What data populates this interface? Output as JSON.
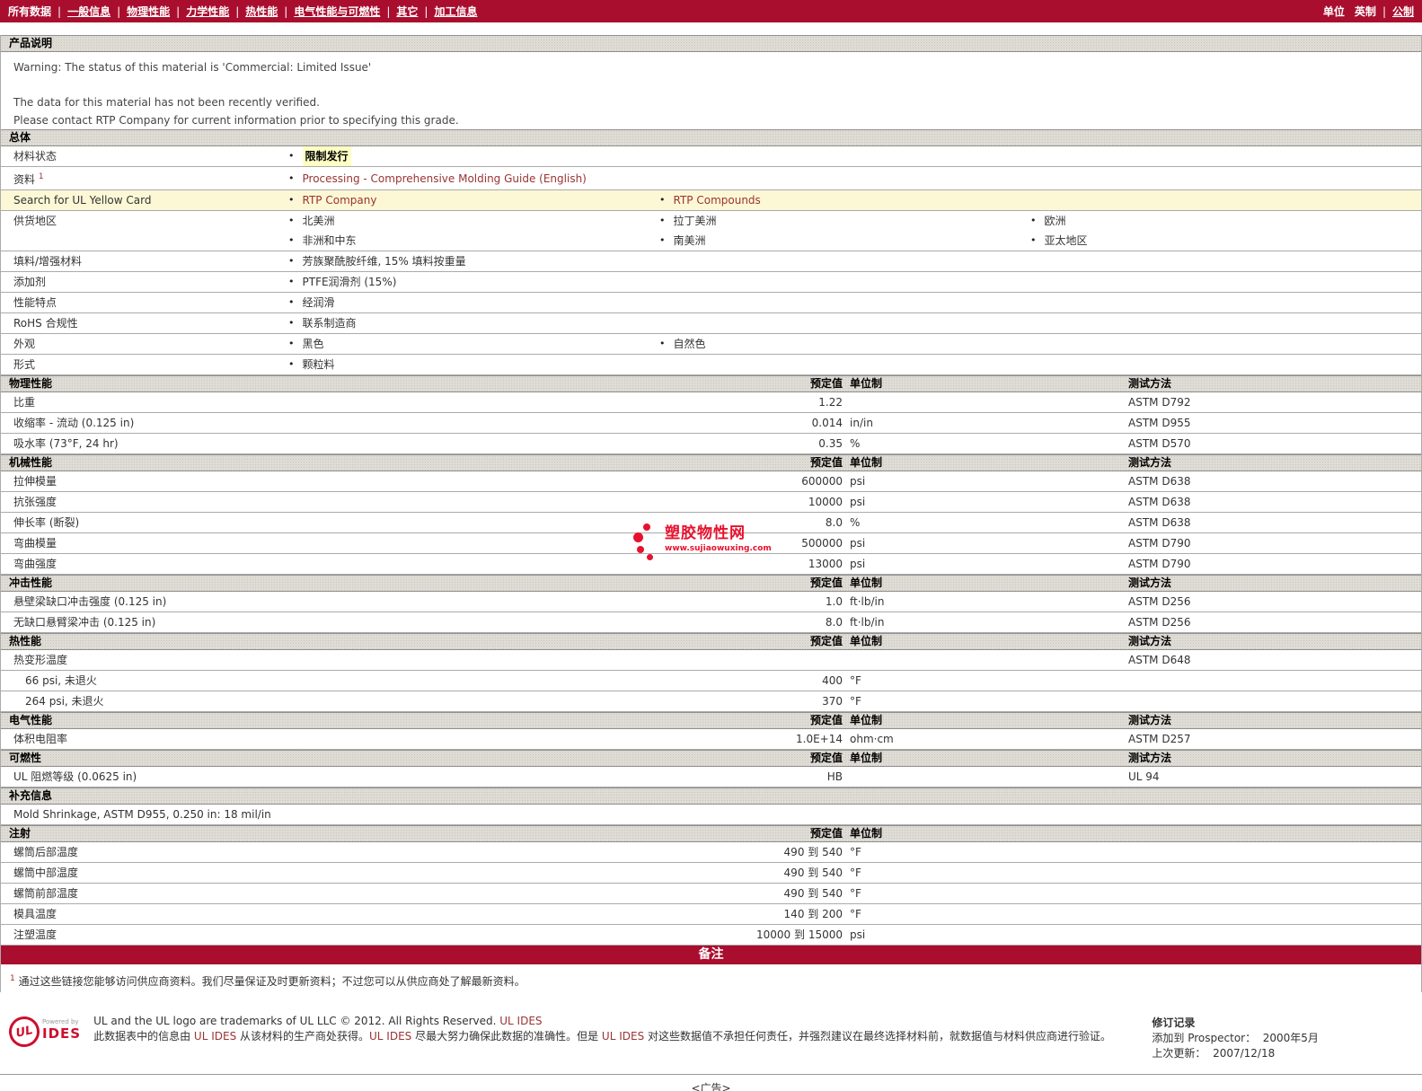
{
  "nav": {
    "items": [
      "所有数据",
      "一般信息",
      "物理性能",
      "力学性能",
      "热性能",
      "电气性能与可燃性",
      "其它",
      "加工信息"
    ],
    "units_label": "单位",
    "unit_current": "英制",
    "unit_alt": "公制"
  },
  "columns": {
    "value": "预定值",
    "unit": "单位制",
    "test": "测试方法"
  },
  "description": {
    "title": "产品说明",
    "line1": "Warning: The status of this material is 'Commercial: Limited Issue'",
    "line2": "The data for this material has not been recently verified.",
    "line3": "Please contact RTP Company for current information prior to specifying this grade."
  },
  "general": {
    "title": "总体",
    "status": {
      "label": "材料状态",
      "value": "限制发行"
    },
    "resources": {
      "label": "资料",
      "sup": "1",
      "value": "Processing - Comprehensive Molding Guide (English)"
    },
    "yellowcard": {
      "label": "Search for UL Yellow Card",
      "link1": "RTP Company",
      "link2": "RTP Compounds"
    },
    "regions": {
      "label": "供货地区",
      "col1": [
        "北美洲",
        "非洲和中东"
      ],
      "col2": [
        "拉丁美洲",
        "南美洲"
      ],
      "col3": [
        "欧洲",
        "亚太地区"
      ]
    },
    "filler": {
      "label": "填料/增强材料",
      "value": "芳族聚酰胺纤维, 15% 填料按重量"
    },
    "additive": {
      "label": "添加剂",
      "value": "PTFE润滑剂 (15%)"
    },
    "features": {
      "label": "性能特点",
      "value": "经润滑"
    },
    "rohs": {
      "label": "RoHS 合规性",
      "value": "联系制造商"
    },
    "appearance": {
      "label": "外观",
      "value1": "黑色",
      "value2": "自然色"
    },
    "form": {
      "label": "形式",
      "value": "颗粒料"
    }
  },
  "physical": {
    "title": "物理性能",
    "rows": [
      {
        "label": "比重",
        "value": "1.22",
        "unit": "",
        "test": "ASTM D792"
      },
      {
        "label": "收缩率 - 流动 (0.125 in)",
        "value": "0.014",
        "unit": "in/in",
        "test": "ASTM D955"
      },
      {
        "label": "吸水率 (73°F, 24 hr)",
        "value": "0.35",
        "unit": "%",
        "test": "ASTM D570"
      }
    ]
  },
  "mechanical": {
    "title": "机械性能",
    "rows": [
      {
        "label": "拉伸模量",
        "value": "600000",
        "unit": "psi",
        "test": "ASTM D638"
      },
      {
        "label": "抗张强度",
        "value": "10000",
        "unit": "psi",
        "test": "ASTM D638"
      },
      {
        "label": "伸长率 (断裂)",
        "value": "8.0",
        "unit": "%",
        "test": "ASTM D638"
      },
      {
        "label": "弯曲模量",
        "value": "500000",
        "unit": "psi",
        "test": "ASTM D790"
      },
      {
        "label": "弯曲强度",
        "value": "13000",
        "unit": "psi",
        "test": "ASTM D790"
      }
    ]
  },
  "impact": {
    "title": "冲击性能",
    "rows": [
      {
        "label": "悬壁梁缺口冲击强度 (0.125 in)",
        "value": "1.0",
        "unit": "ft·lb/in",
        "test": "ASTM D256"
      },
      {
        "label": "无缺口悬臂梁冲击 (0.125 in)",
        "value": "8.0",
        "unit": "ft·lb/in",
        "test": "ASTM D256"
      }
    ]
  },
  "thermal": {
    "title": "热性能",
    "rows": [
      {
        "label": "热变形温度",
        "value": "",
        "unit": "",
        "test": "ASTM D648"
      },
      {
        "label": "66 psi, 未退火",
        "value": "400",
        "unit": "°F",
        "test": ""
      },
      {
        "label": "264 psi, 未退火",
        "value": "370",
        "unit": "°F",
        "test": ""
      }
    ]
  },
  "electrical": {
    "title": "电气性能",
    "rows": [
      {
        "label": "体积电阻率",
        "value": "1.0E+14",
        "unit": "ohm·cm",
        "test": "ASTM D257"
      }
    ]
  },
  "flammability": {
    "title": "可燃性",
    "rows": [
      {
        "label": "UL 阻燃等级 (0.0625 in)",
        "value": "HB",
        "unit": "",
        "test": "UL 94"
      }
    ]
  },
  "supplemental": {
    "title": "补充信息",
    "text": "Mold Shrinkage, ASTM D955, 0.250 in: 18 mil/in"
  },
  "injection": {
    "title": "注射",
    "rows": [
      {
        "label": "螺筒后部温度",
        "value": "490 到 540",
        "unit": "°F"
      },
      {
        "label": "螺筒中部温度",
        "value": "490 到 540",
        "unit": "°F"
      },
      {
        "label": "螺筒前部温度",
        "value": "490 到 540",
        "unit": "°F"
      },
      {
        "label": "模具温度",
        "value": "140 到 200",
        "unit": "°F"
      },
      {
        "label": "注塑温度",
        "value": "10000 到 15000",
        "unit": "psi"
      }
    ]
  },
  "notes": {
    "bar": "备注",
    "sup": "1",
    "text": "通过这些链接您能够访问供应商资料。我们尽量保证及时更新资料；不过您可以从供应商处了解最新资料。"
  },
  "footer": {
    "ul": "UL",
    "powered_by": "Powered by",
    "ides": "IDES",
    "line1": "UL and the UL logo are trademarks of UL LLC © 2012. All Rights Reserved. ",
    "line1_link": "UL IDES",
    "seg1": "此数据表中的信息由 ",
    "link1": "UL IDES",
    "seg2": " 从该材料的生产商处获得。",
    "link2": "UL IDES",
    "seg3": " 尽最大努力确保此数据的准确性。但是 ",
    "link3": "UL IDES",
    "seg4": " 对这些数据值不承担任何责任，并强烈建议在最终选择材料前，就数据值与材料供应商进行验证。",
    "revision_title": "修订记录",
    "added_label": "添加到  Prospector：",
    "added_value": "2000年5月",
    "updated_label": "上次更新：",
    "updated_value": "2007/12/18"
  },
  "watermark": {
    "name": "塑胶物性网",
    "url": "www.sujiaowuxing.com"
  },
  "ad": {
    "label": "<广告>"
  },
  "colors": {
    "brand_red": "#A90E2F",
    "link": "#993333",
    "row_highlight": "#FCF8D6"
  }
}
